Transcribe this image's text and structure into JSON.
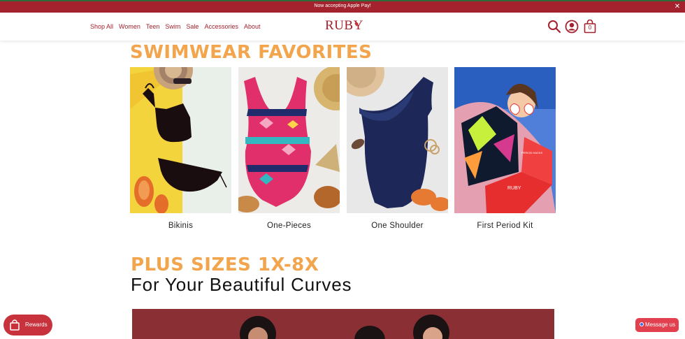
{
  "promo": {
    "text": "Now accepting Apple Pay!",
    "close": "✕"
  },
  "nav": {
    "items": [
      "Shop All",
      "Women",
      "Teen",
      "Swim",
      "Sale",
      "Accessories",
      "About"
    ]
  },
  "logo": {
    "text": "RUBY",
    "heart": "♥"
  },
  "header_icons": {
    "search": "search-icon",
    "account": "account-icon",
    "cart": "cart-icon",
    "cart_count": "0"
  },
  "swimwear": {
    "title": "SWIMWEAR FAVORITES",
    "cards": [
      {
        "label": "Bikinis"
      },
      {
        "label": "One-Pieces"
      },
      {
        "label": "One Shoulder"
      },
      {
        "label": "First Period Kit",
        "box_text": "PERIOD HACKS",
        "box_logo": "RUBY"
      }
    ]
  },
  "plus": {
    "title": "PLUS SIZES 1X-8X",
    "subtitle": "For Your Beautiful Curves"
  },
  "rewards": {
    "label": "Rewards"
  },
  "message": {
    "label": "Message us"
  },
  "colors": {
    "brand": "#a3222d",
    "accent": "#f2a54c",
    "message": "#e23f4f"
  }
}
